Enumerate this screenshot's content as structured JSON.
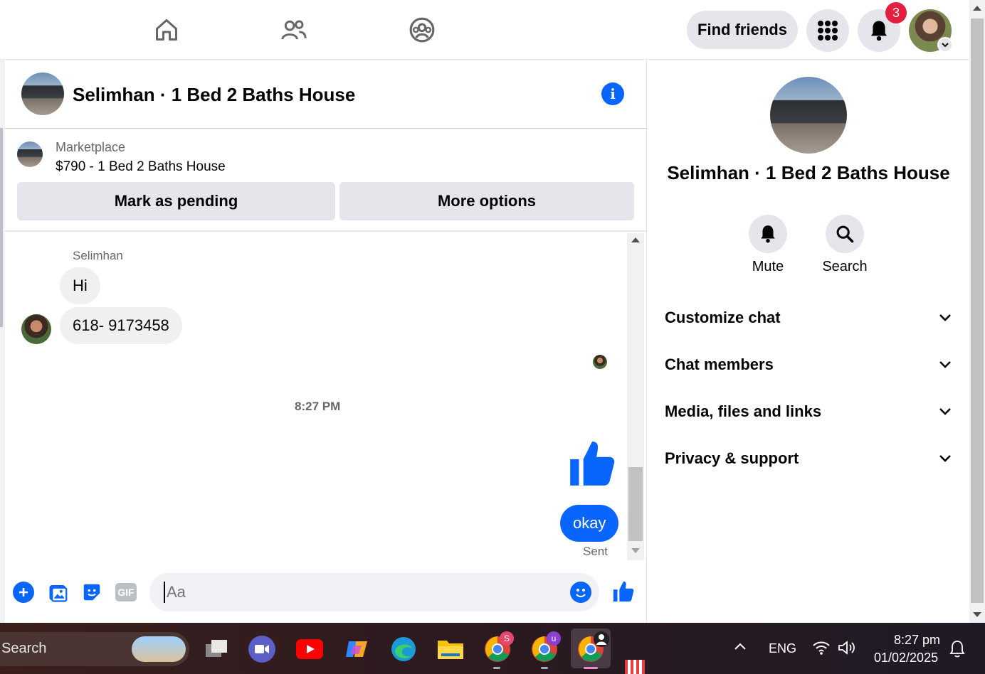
{
  "topbar": {
    "find_friends_label": "Find friends",
    "notification_count": "3"
  },
  "chat": {
    "title": "Selimhan · 1 Bed 2 Baths House",
    "marketplace_label": "Marketplace",
    "listing_price": "$790 - 1 Bed 2 Baths House",
    "mark_pending_label": "Mark as pending",
    "more_options_label": "More options",
    "sender_name": "Selimhan",
    "messages": [
      {
        "from": "Selimhan",
        "text": "Hi"
      },
      {
        "from": "Selimhan",
        "text": "618- 9173458"
      }
    ],
    "timestamp": "8:27 PM",
    "my_reply": "okay",
    "status": "Sent",
    "composer_placeholder": "Aa"
  },
  "details": {
    "title": "Selimhan · 1 Bed 2 Baths House",
    "mute_label": "Mute",
    "search_label": "Search",
    "sections": [
      "Customize chat",
      "Chat members",
      "Media, files and links",
      "Privacy & support"
    ]
  },
  "taskbar": {
    "search_text": "Search",
    "language": "ENG",
    "time": "8:27 pm",
    "date": "01/02/2025"
  },
  "colors": {
    "accent": "#0866ff",
    "badge": "#e41e3f"
  }
}
